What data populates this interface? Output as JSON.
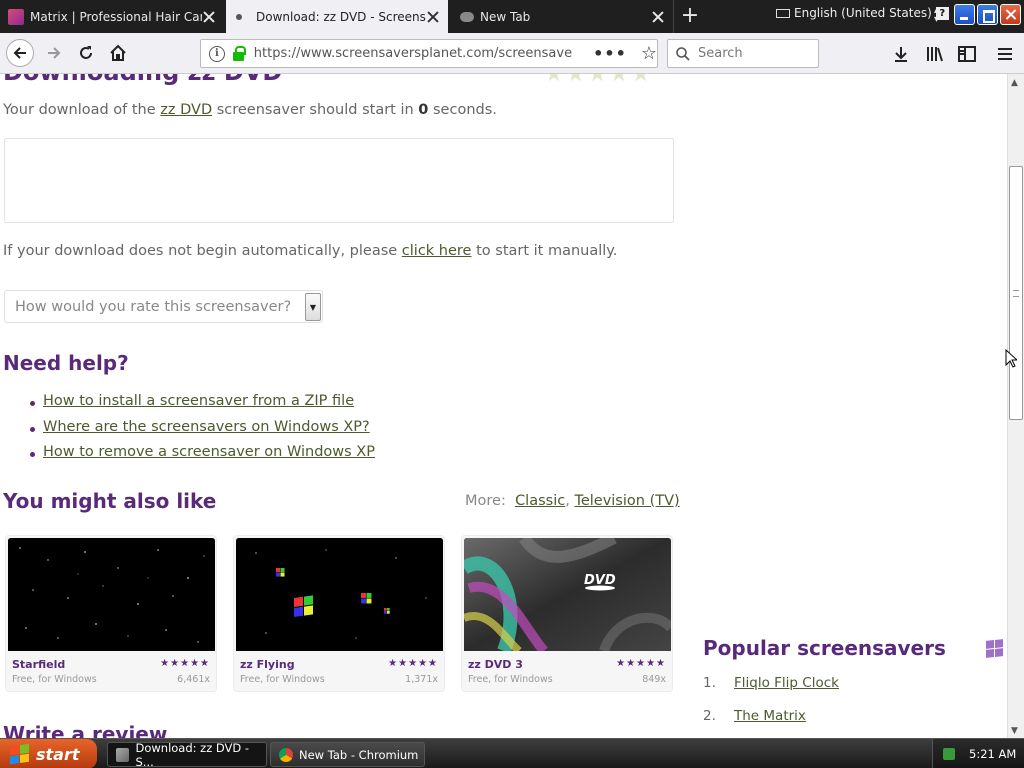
{
  "browser": {
    "tabs": [
      {
        "title": "Matrix | Professional Hair Care & S"
      },
      {
        "title": "Download: zz DVD - Screensavers"
      },
      {
        "title": "New Tab"
      }
    ],
    "language": "English (United States)",
    "url": "https://www.screensaversplanet.com/screensavers/zz",
    "search_placeholder": "Search"
  },
  "page": {
    "heading_partial": "Downloading zz DVD",
    "download_text_before": "Your download of the ",
    "download_link": "zz DVD",
    "download_text_middle": " screensaver should start in ",
    "countdown": "0",
    "download_text_after": " seconds.",
    "manual_before": "If your download does not begin automatically, please ",
    "manual_link": "click here",
    "manual_after": " to start it manually.",
    "rate_placeholder": "How would you rate this screensaver?",
    "help_heading": "Need help?",
    "help_links": [
      "How to install a screensaver from a ZIP file",
      "Where are the screensavers on Windows XP?",
      "How to remove a screensaver on Windows XP"
    ],
    "like_heading": "You might also like",
    "more_label": "More:",
    "more_links": [
      "Classic",
      "Television (TV)"
    ],
    "cards": [
      {
        "name": "Starfield",
        "sub": "Free, for Windows",
        "count": "6,461x",
        "rating": 5
      },
      {
        "name": "zz Flying",
        "sub": "Free, for Windows",
        "count": "1,371x",
        "rating": 5
      },
      {
        "name": "zz DVD 3",
        "sub": "Free, for Windows",
        "count": "849x",
        "rating": 5
      }
    ],
    "review_heading": "Write a review",
    "popular_heading": "Popular screensavers",
    "popular": [
      {
        "num": "1.",
        "name": "Fliqlo Flip Clock"
      },
      {
        "num": "2.",
        "name": "The Matrix"
      }
    ]
  },
  "taskbar": {
    "start": "start",
    "items": [
      {
        "label": "Download: zz DVD - S..."
      },
      {
        "label": "New Tab - Chromium"
      }
    ],
    "clock": "5:21 AM"
  }
}
